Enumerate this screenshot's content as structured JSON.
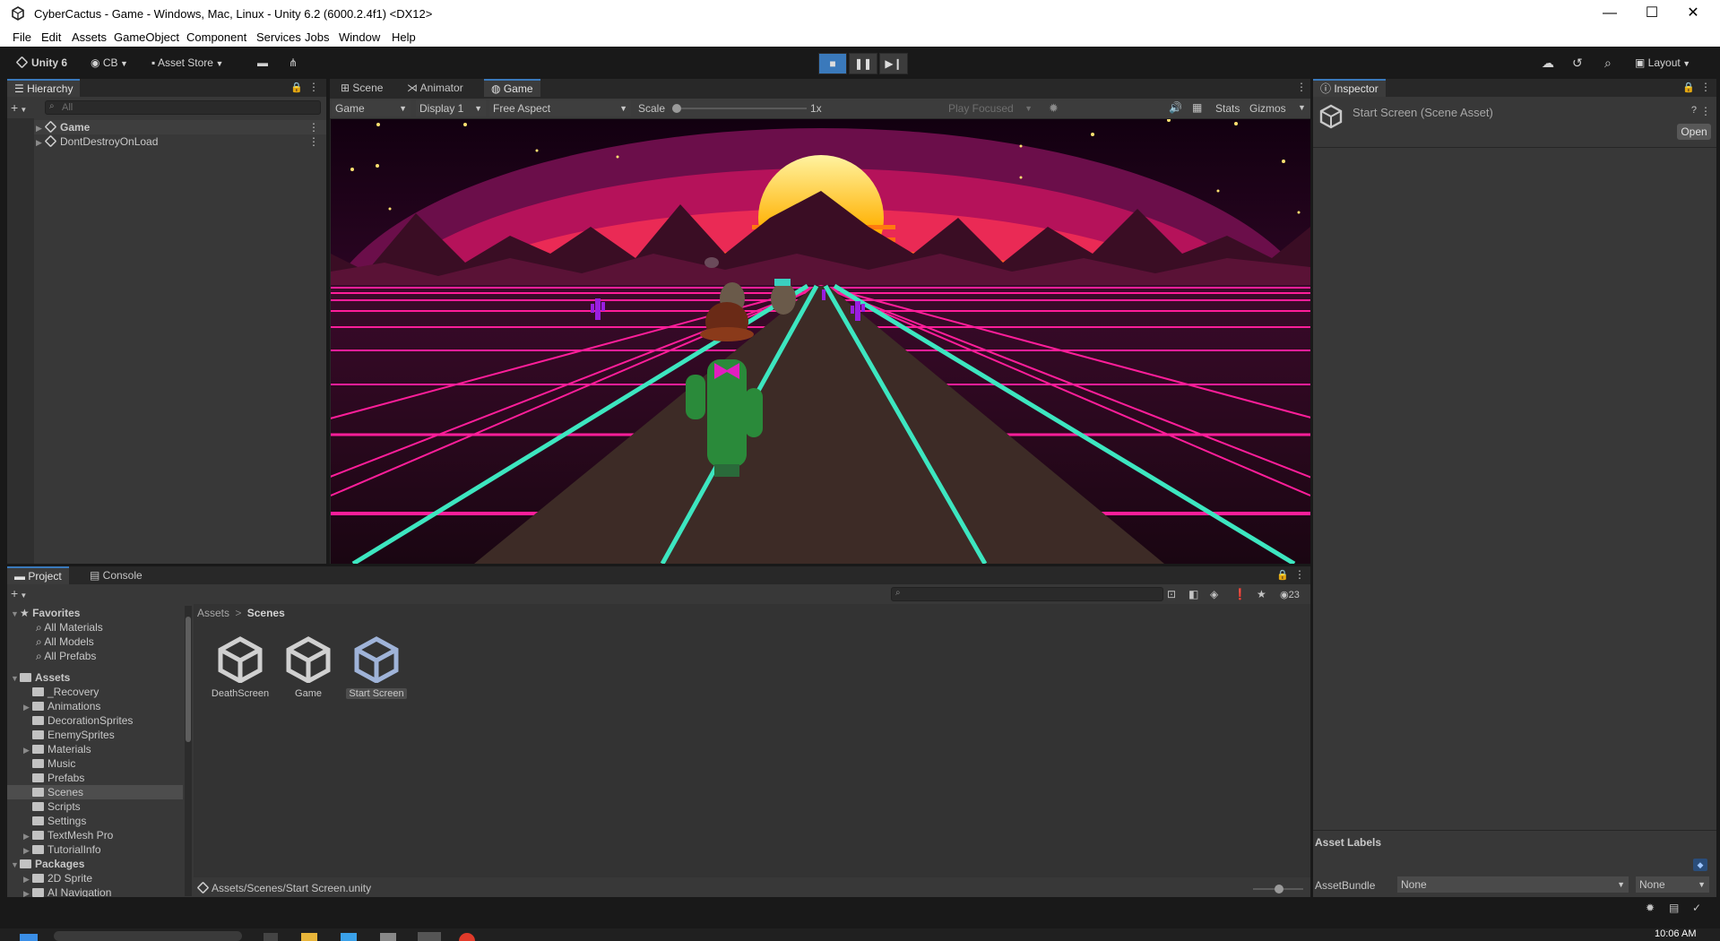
{
  "window": {
    "title": "CyberCactus - Game - Windows, Mac, Linux - Unity 6.2 (6000.2.4f1) <DX12>",
    "controls": {
      "minimize": "—",
      "maximize": "☐",
      "close": "✕"
    }
  },
  "menu": [
    "File",
    "Edit",
    "Assets",
    "GameObject",
    "Component",
    "Services",
    "Jobs",
    "Window",
    "Help"
  ],
  "toolbar": {
    "unity_label": "Unity 6",
    "account_label": "CB",
    "asset_store_label": "Asset Store",
    "layout_label": "Layout",
    "play_controls": {
      "stop": "■",
      "pause": "❚❚",
      "step": "▶❙"
    },
    "accent_color": "#3a79bb"
  },
  "hierarchy": {
    "tab_label": "Hierarchy",
    "search_placeholder": "All",
    "items": [
      {
        "label": "Game",
        "bold": true
      },
      {
        "label": "DontDestroyOnLoad",
        "bold": false
      }
    ]
  },
  "center_tabs": [
    {
      "label": "Scene",
      "icon": "grid-icon"
    },
    {
      "label": "Animator",
      "icon": "animator-icon"
    },
    {
      "label": "Game",
      "icon": "gamepad-icon",
      "active": true
    }
  ],
  "game_toolbar": {
    "display_mode": "Game",
    "display": "Display 1",
    "aspect": "Free Aspect",
    "scale_label": "Scale",
    "scale_value": "1x",
    "play_focus": "Play Focused",
    "stats_label": "Stats",
    "gizmos_label": "Gizmos"
  },
  "inspector": {
    "tab_label": "Inspector",
    "asset_title": "Start Screen (Scene Asset)",
    "open_button": "Open",
    "asset_labels_header": "Asset Labels",
    "asset_bundle_label": "AssetBundle",
    "asset_bundle_value": "None",
    "asset_bundle_variant": "None"
  },
  "bottom_tabs": [
    {
      "label": "Project",
      "icon": "folder-icon",
      "active": true
    },
    {
      "label": "Console",
      "icon": "console-icon"
    }
  ],
  "project": {
    "favorites_label": "Favorites",
    "favorites": [
      "All Materials",
      "All Models",
      "All Prefabs"
    ],
    "assets_label": "Assets",
    "asset_folders": [
      {
        "label": "_Recovery",
        "expandable": false
      },
      {
        "label": "Animations",
        "expandable": true
      },
      {
        "label": "DecorationSprites",
        "expandable": false
      },
      {
        "label": "EnemySprites",
        "expandable": false
      },
      {
        "label": "Materials",
        "expandable": true
      },
      {
        "label": "Music",
        "expandable": false
      },
      {
        "label": "Prefabs",
        "expandable": false
      },
      {
        "label": "Scenes",
        "expandable": false,
        "selected": true
      },
      {
        "label": "Scripts",
        "expandable": false
      },
      {
        "label": "Settings",
        "expandable": false
      },
      {
        "label": "TextMesh Pro",
        "expandable": true
      },
      {
        "label": "TutorialInfo",
        "expandable": true
      }
    ],
    "packages_label": "Packages",
    "packages": [
      {
        "label": "2D Sprite",
        "expandable": true
      },
      {
        "label": "AI Navigation",
        "expandable": true
      }
    ],
    "breadcrumb": [
      "Assets",
      "Scenes"
    ],
    "breadcrumb_sep": ">",
    "hidden_count": "23",
    "files": [
      {
        "label": "DeathScreen",
        "selected": false
      },
      {
        "label": "Game",
        "selected": false
      },
      {
        "label": "Start Screen",
        "selected": true
      }
    ],
    "status_path": "Assets/Scenes/Start Screen.unity"
  },
  "taskbar": {
    "clock": "10:06 AM"
  }
}
